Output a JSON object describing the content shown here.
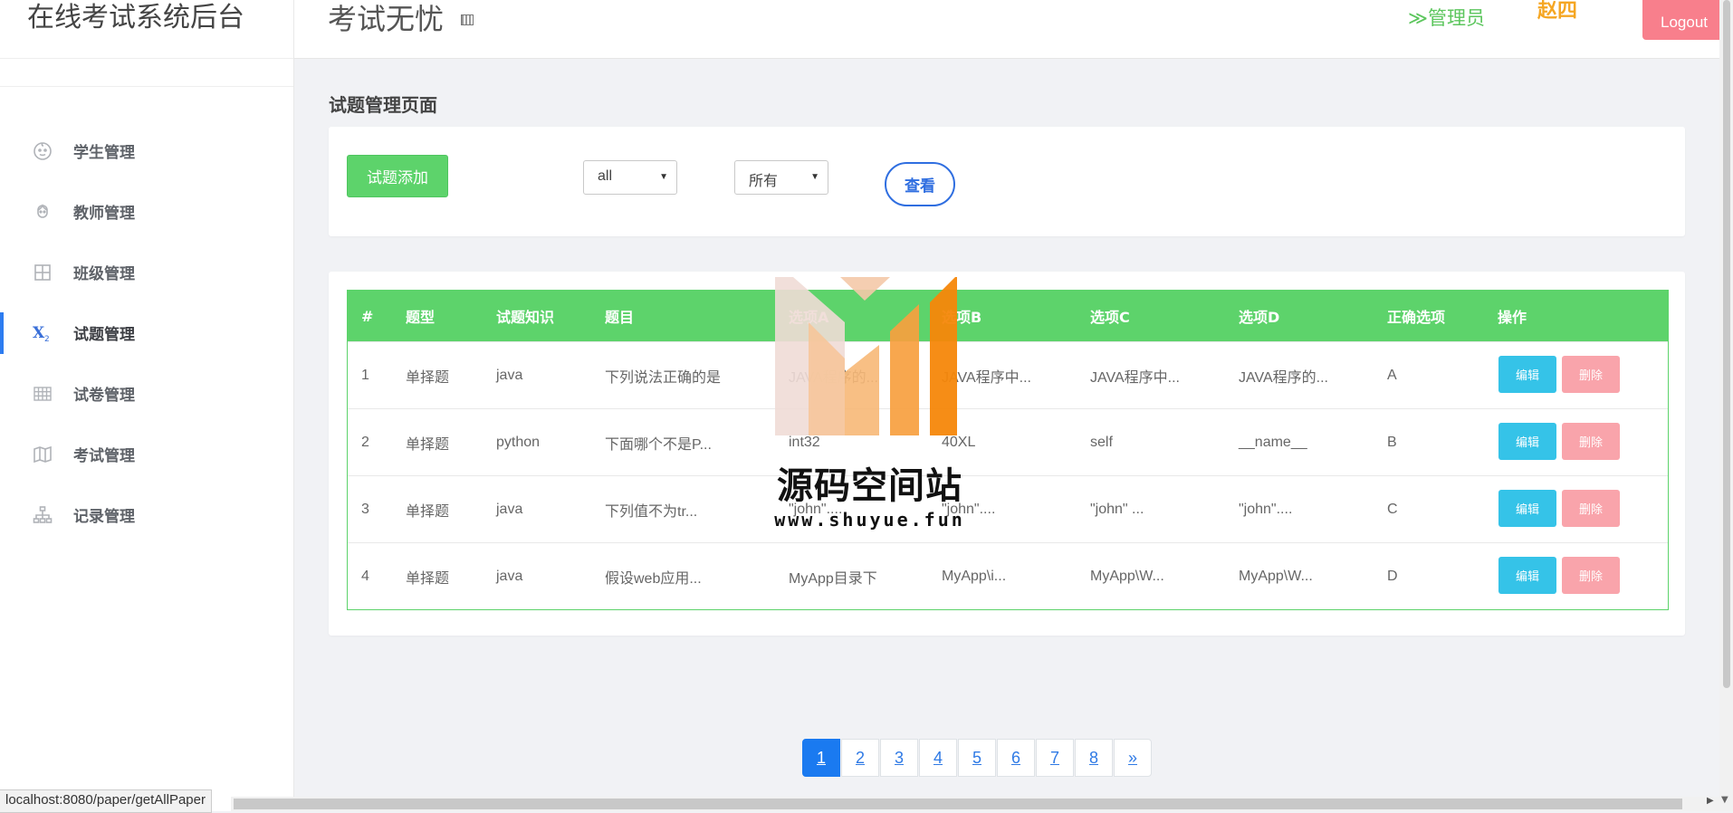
{
  "sidebar": {
    "brand": "在线考试系统后台",
    "items": [
      {
        "label": "学生管理",
        "icon": "student-icon"
      },
      {
        "label": "教师管理",
        "icon": "teacher-icon"
      },
      {
        "label": "班级管理",
        "icon": "class-icon"
      },
      {
        "label": "试题管理",
        "icon": "subscript-icon",
        "active": true
      },
      {
        "label": "试卷管理",
        "icon": "grid-icon"
      },
      {
        "label": "考试管理",
        "icon": "map-icon"
      },
      {
        "label": "记录管理",
        "icon": "sitemap-icon"
      }
    ]
  },
  "header": {
    "title": "考试无忧",
    "role": "≫管理员",
    "username": "赵四",
    "logout": "Logout"
  },
  "page": {
    "heading": "试题管理页面"
  },
  "toolbar": {
    "add_label": "试题添加",
    "type_select": "all",
    "knowledge_select": "所有",
    "view_label": "查看"
  },
  "table": {
    "columns": [
      "#",
      "题型",
      "试题知识",
      "题目",
      "选项A",
      "选项B",
      "选项C",
      "选项D",
      "正确选项",
      "操作"
    ],
    "rows": [
      [
        "1",
        "单择题",
        "java",
        "下列说法正确的是",
        "JAVA程序的...",
        "JAVA程序中...",
        "JAVA程序中...",
        "JAVA程序的...",
        "A"
      ],
      [
        "2",
        "单择题",
        "python",
        "下面哪个不是P...",
        "int32",
        "40XL",
        "self",
        "__name__",
        "B"
      ],
      [
        "3",
        "单择题",
        "java",
        "下列值不为tr...",
        "\"john\"....",
        "\"john\"....",
        "\"john\" ...",
        "\"john\"....",
        "C"
      ],
      [
        "4",
        "单择题",
        "java",
        "假设web应用...",
        "MyApp目录下",
        "MyApp\\i...",
        "MyApp\\W...",
        "MyApp\\W...",
        "D"
      ]
    ],
    "edit_label": "编辑",
    "delete_label": "删除"
  },
  "pagination": {
    "pages": [
      "1",
      "2",
      "3",
      "4",
      "5",
      "6",
      "7",
      "8",
      "»"
    ],
    "current": "1"
  },
  "watermark": {
    "text": "源码空间站",
    "url": "www.shuyue.fun"
  },
  "status_bar": "localhost:8080/paper/getAllPaper",
  "colors": {
    "accent_green": "#5dd36b",
    "edit_blue": "#35c3e8",
    "delete_pink": "#f9a4ab",
    "logout_red": "#f87f8c",
    "username_orange": "#f5a623",
    "role_green": "#5cc65d",
    "view_blue": "#2f6ee0",
    "page_active": "#1a7af0"
  }
}
